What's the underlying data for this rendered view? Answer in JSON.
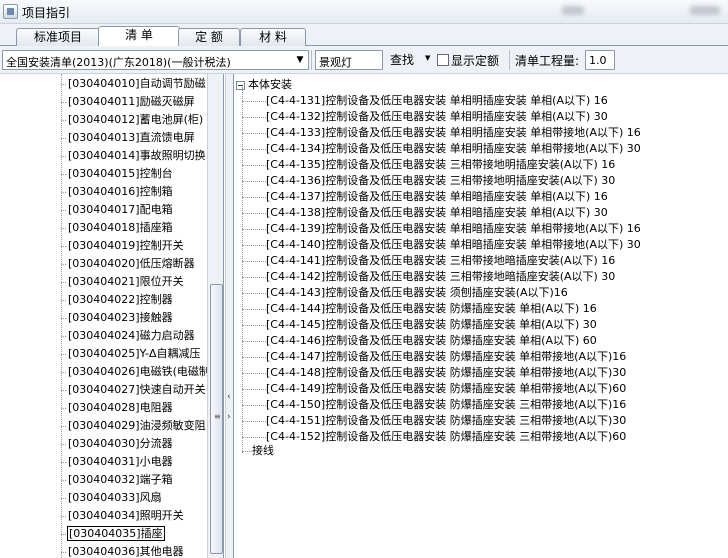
{
  "window": {
    "title": "项目指引",
    "accent": "#6f87a8"
  },
  "tabs": [
    "标准项目",
    "清 单",
    "定 额",
    "材 料"
  ],
  "active_tab": "清 单",
  "toolbar": {
    "library": "全国安装清单(2013)(广东2018)(一般计税法)",
    "keyword": "景观灯",
    "find_label": "查找",
    "show_quota_label": "显示定额",
    "show_quota_checked": false,
    "qty_label": "清单工程量:",
    "qty_value": "1.0"
  },
  "left_list": [
    "[030404010]自动调节励磁",
    "[030404011]励磁灭磁屏",
    "[030404012]蓄电池屏(柜)",
    "[030404013]直流馈电屏",
    "[030404014]事故照明切换",
    "[030404015]控制台",
    "[030404016]控制箱",
    "[030404017]配电箱",
    "[030404018]插座箱",
    "[030404019]控制开关",
    "[030404020]低压熔断器",
    "[030404021]限位开关",
    "[030404022]控制器",
    "[030404023]接触器",
    "[030404024]磁力启动器",
    "[030404025]Y-Δ自耦减压",
    "[030404026]电磁铁(电磁制",
    "[030404027]快速自动开关",
    "[030404028]电阻器",
    "[030404029]油浸频敏变阻",
    "[030404030]分流器",
    "[030404031]小电器",
    "[030404032]端子箱",
    "[030404033]风扇",
    "[030404034]照明开关",
    "[030404035]插座",
    "[030404036]其他电器"
  ],
  "left_selected_index": 25,
  "right_tree": {
    "root": "本体安装",
    "items": [
      "[C4-4-131]控制设备及低压电器安装 单相明插座安装 单相(A以下) 16",
      "[C4-4-132]控制设备及低压电器安装 单相明插座安装 单相(A以下) 30",
      "[C4-4-133]控制设备及低压电器安装 单相明插座安装 单相带接地(A以下) 16",
      "[C4-4-134]控制设备及低压电器安装 单相明插座安装 单相带接地(A以下) 30",
      "[C4-4-135]控制设备及低压电器安装 三相带接地明插座安装(A以下) 16",
      "[C4-4-136]控制设备及低压电器安装 三相带接地明插座安装(A以下) 30",
      "[C4-4-137]控制设备及低压电器安装 单相暗插座安装 单相(A以下) 16",
      "[C4-4-138]控制设备及低压电器安装 单相暗插座安装 单相(A以下) 30",
      "[C4-4-139]控制设备及低压电器安装 单相暗插座安装 单相带接地(A以下) 16",
      "[C4-4-140]控制设备及低压电器安装 单相暗插座安装 单相带接地(A以下) 30",
      "[C4-4-141]控制设备及低压电器安装 三相带接地暗插座安装(A以下) 16",
      "[C4-4-142]控制设备及低压电器安装 三相带接地暗插座安装(A以下) 30",
      "[C4-4-143]控制设备及低压电器安装 须刨插座安装(A以下)16",
      "[C4-4-144]控制设备及低压电器安装 防爆插座安装 单相(A以下) 16",
      "[C4-4-145]控制设备及低压电器安装 防爆插座安装 单相(A以下) 30",
      "[C4-4-146]控制设备及低压电器安装 防爆插座安装 单相(A以下) 60",
      "[C4-4-147]控制设备及低压电器安装 防爆插座安装 单相带接地(A以下)16",
      "[C4-4-148]控制设备及低压电器安装 防爆插座安装 单相带接地(A以下)30",
      "[C4-4-149]控制设备及低压电器安装 防爆插座安装 单相带接地(A以下)60",
      "[C4-4-150]控制设备及低压电器安装 防爆插座安装 三相带接地(A以下)16",
      "[C4-4-151]控制设备及低压电器安装 防爆插座安装 三相带接地(A以下)30",
      "[C4-4-152]控制设备及低压电器安装 防爆插座安装 三相带接地(A以下)60"
    ],
    "second_root": "接线"
  }
}
